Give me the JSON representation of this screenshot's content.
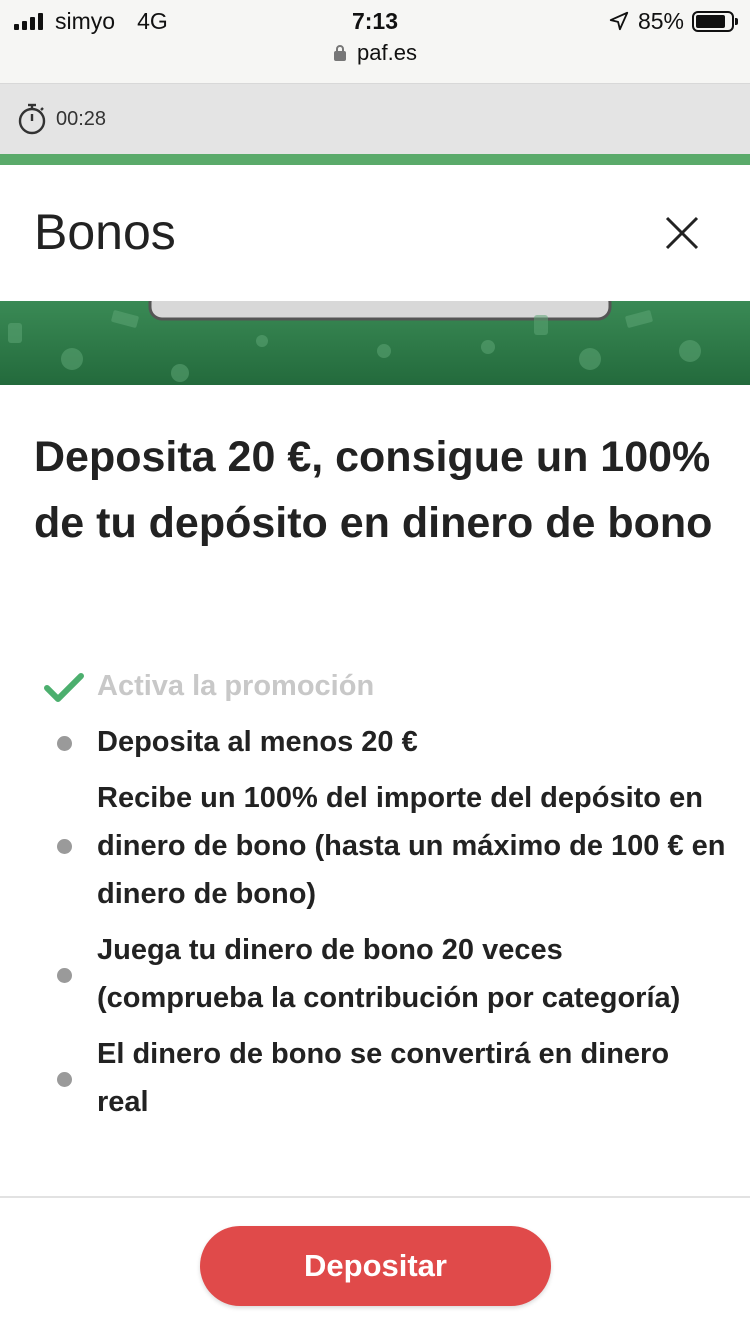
{
  "status_bar": {
    "carrier": "simyo",
    "network": "4G",
    "time": "7:13",
    "battery": "85%",
    "battery_level": 0.85
  },
  "browser": {
    "url": "paf.es"
  },
  "timer": {
    "value": "00:28"
  },
  "header": {
    "title": "Bonos"
  },
  "offer": {
    "headline": "Deposita 20 €, consigue un 100% de tu depósito en dinero de bono",
    "steps": [
      {
        "label": "Activa la promoción",
        "state": "completed",
        "icon": "check-icon"
      },
      {
        "label": "Deposita al menos 20 €",
        "state": "pending",
        "icon": "bullet-icon"
      },
      {
        "label": "Recibe un 100% del importe del depósito en dinero de bono (hasta un máximo de 100 € en dinero de bono)",
        "state": "pending",
        "icon": "bullet-icon"
      },
      {
        "label": "Juega tu dinero de bono 20 veces (comprueba la contribución por categoría)",
        "state": "pending",
        "icon": "bullet-icon"
      },
      {
        "label": "El dinero de bono se convertirá en dinero real",
        "state": "pending",
        "icon": "bullet-icon"
      }
    ]
  },
  "footer": {
    "deposit_label": "Depositar"
  },
  "colors": {
    "accent_green": "#5aaa6a",
    "banner_green": "#2f7a4a",
    "button_red": "#e04a4a",
    "check_green": "#4caf6e"
  }
}
